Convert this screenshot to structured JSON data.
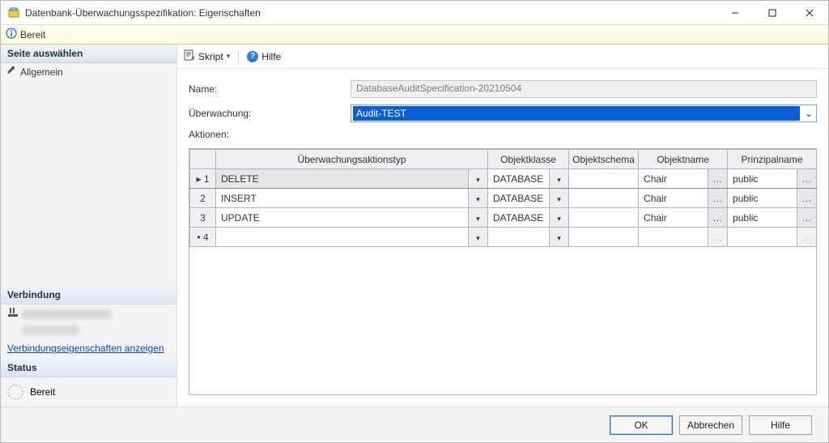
{
  "window": {
    "title": "Datenbank-Überwachungsspezifikation: Eigenschaften"
  },
  "status_ready": "Bereit",
  "sidebar": {
    "select_page": "Seite auswählen",
    "general": "Allgemein",
    "connection_header": "Verbindung",
    "view_conn_props": "Verbindungseigenschaften anzeigen",
    "status_header": "Status",
    "status_value": "Bereit"
  },
  "toolbar": {
    "script": "Skript",
    "help": "Hilfe"
  },
  "form": {
    "name_label": "Name:",
    "name_value": "DatabaseAuditSpecification-20210504",
    "audit_label": "Überwachung:",
    "audit_value": "Audit-TEST",
    "actions_label": "Aktionen:"
  },
  "grid": {
    "headers": {
      "action_type": "Überwachungsaktionstyp",
      "object_class": "Objektklasse",
      "object_schema": "Objektschema",
      "object_name": "Objektname",
      "principal_name": "Prinzipalname"
    },
    "rows": [
      {
        "num": "1",
        "marker": "▸",
        "action": "DELETE",
        "oclass": "DATABASE",
        "oschema": "",
        "oname": "Chair",
        "principal": "public",
        "current": true
      },
      {
        "num": "2",
        "marker": "",
        "action": "INSERT",
        "oclass": "DATABASE",
        "oschema": "",
        "oname": "Chair",
        "principal": "public",
        "current": false
      },
      {
        "num": "3",
        "marker": "",
        "action": "UPDATE",
        "oclass": "DATABASE",
        "oschema": "",
        "oname": "Chair",
        "principal": "public",
        "current": false
      },
      {
        "num": "4",
        "marker": "•",
        "action": "",
        "oclass": "",
        "oschema": "",
        "oname": "",
        "principal": "",
        "current": false,
        "empty": true
      }
    ]
  },
  "footer": {
    "ok": "OK",
    "cancel": "Abbrechen",
    "help": "Hilfe"
  }
}
